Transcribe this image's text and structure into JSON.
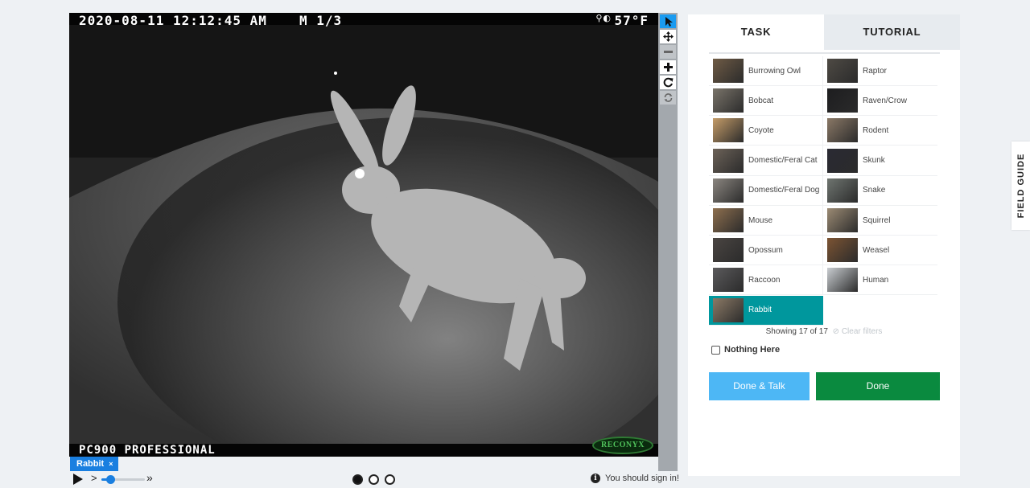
{
  "viewer": {
    "stamp_datetime": "2020-08-11 12:12:45 AM",
    "stamp_frame": "M 1/3",
    "stamp_temp": "57°F",
    "stamp_moon": "⚲◐",
    "stamp_model": "PC900 PROFESSIONAL",
    "brand": "RECONYX"
  },
  "toolbar": [
    {
      "name": "annotate-tool",
      "icon": "cursor-icon",
      "state": "active"
    },
    {
      "name": "move-tool",
      "icon": "move-icon",
      "state": "normal"
    },
    {
      "name": "zoom-out-button",
      "icon": "minus-icon",
      "state": "disabled"
    },
    {
      "name": "zoom-in-button",
      "icon": "plus-icon",
      "state": "normal"
    },
    {
      "name": "rotate-button",
      "icon": "rotate-icon",
      "state": "normal"
    },
    {
      "name": "reset-button",
      "icon": "reset-icon",
      "state": "disabled"
    }
  ],
  "subject_tag": {
    "label": "Rabbit",
    "remove": "×"
  },
  "playback": {
    "slower": ">",
    "faster": "»",
    "speed_fraction": 0.2,
    "frames": 3,
    "current_frame": 1
  },
  "signin_text": "You should sign in!",
  "tabs": {
    "task": "TASK",
    "tutorial": "TUTORIAL"
  },
  "choices": [
    {
      "label": "Burrowing Owl",
      "color": "#6f5b45"
    },
    {
      "label": "Raptor",
      "color": "#4e4a44"
    },
    {
      "label": "Bobcat",
      "color": "#7a746a"
    },
    {
      "label": "Raven/Crow",
      "color": "#1d1d1f"
    },
    {
      "label": "Coyote",
      "color": "#c59c68"
    },
    {
      "label": "Rodent",
      "color": "#8a7866"
    },
    {
      "label": "Domestic/Feral Cat",
      "color": "#6c6258"
    },
    {
      "label": "Skunk",
      "color": "#2a2a33"
    },
    {
      "label": "Domestic/Feral Dog",
      "color": "#8b8680"
    },
    {
      "label": "Snake",
      "color": "#6f7570"
    },
    {
      "label": "Mouse",
      "color": "#8e6f4e"
    },
    {
      "label": "Squirrel",
      "color": "#9c8b74"
    },
    {
      "label": "Opossum",
      "color": "#4a4542"
    },
    {
      "label": "Weasel",
      "color": "#7c5433"
    },
    {
      "label": "Raccoon",
      "color": "#5b5a5c"
    },
    {
      "label": "Human",
      "color": "#c9cdd1"
    },
    {
      "label": "Rabbit",
      "color": "#8c7a66",
      "selected": true
    }
  ],
  "showing": {
    "text": "Showing 17 of 17",
    "clear": "Clear filters"
  },
  "nothing_here": "Nothing Here",
  "buttons": {
    "done_talk": "Done & Talk",
    "done": "Done"
  },
  "field_guide": "FIELD GUIDE"
}
